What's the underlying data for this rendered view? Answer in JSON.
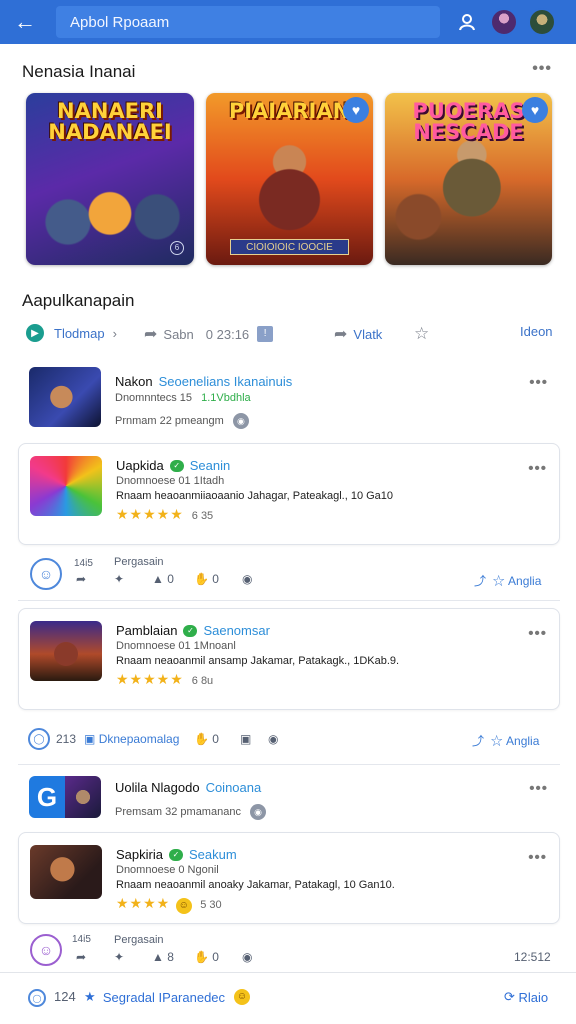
{
  "header": {
    "back_icon": "arrow-left-icon",
    "search_text": "Apbol Rpoaam",
    "user_icon": "user-outline-icon",
    "avatars": [
      "avatar-purple",
      "avatar-green"
    ],
    "accent": "#2f6fd6"
  },
  "featured": {
    "title": "Nenasia Inanai",
    "more": "•••",
    "cards": [
      {
        "title": "NANAERI NADANAEI",
        "badge": "6"
      },
      {
        "title": "PIAIARIAN",
        "banner": "CIOIOIOIC IOOCIE",
        "badge": "♥"
      },
      {
        "title": "PUOERAS NESCADE",
        "badge": "♥"
      }
    ]
  },
  "apps_section": {
    "title": "Aapulkanapain",
    "filters": {
      "trending": "Tlodmap",
      "trending_suffix": "›",
      "share": "Sabn",
      "count": "0 23:16",
      "count_badge": "!",
      "view": "Vlatk",
      "list": "Ideon"
    }
  },
  "apps": [
    {
      "name": "Nakon",
      "tag": "Seoenelians Ikanainuis",
      "line1": "Dnomnntecs 15",
      "line1_extra": "1.1Vbdhla",
      "line2": "Prnmam 22 pmeangm",
      "line2_icon": "eye-icon"
    },
    {
      "name": "Uapkida",
      "tag": "Seanin",
      "line1": "Dnomnoese 01 1Itadh",
      "line2": "Rnaam heaoanmiiaoaanio Jahagar, Pateakagl., 10 Ga10",
      "rating": "★★★★★",
      "score": "6 35"
    },
    {
      "name": "Pamblaian",
      "tag": "Saenomsar",
      "line1": "Dnomnoese 01 1Mnoanl",
      "line2": "Rnaam neaoanmil ansamp Jakamar, Patakagk., 1DKab.9.",
      "rating": "★★★★★",
      "score": "6 8u"
    },
    {
      "name": "Uolila Nlagodo",
      "tag": "Coinoana",
      "line1": "Premsam 32 pmamananc",
      "line1_icon": "eye-icon"
    },
    {
      "name": "Sapkiria",
      "tag": "Seakum",
      "line1": "Dnomnoese 0 Ngonil",
      "line2": "Rnaam neaoanmil anoaky Jakamar, Patakagl, 10 Gan10.",
      "rating": "★★★★",
      "score": "5 30"
    }
  ],
  "actions1": {
    "count": "14i5",
    "label": "Pergasain",
    "like": "0",
    "thumbs": "0",
    "share_label": "Anglia"
  },
  "actions2": {
    "count": "213",
    "label": "Dknepaomalag",
    "thumbs": "0",
    "share_label": "Anglia"
  },
  "actions3": {
    "count": "14i5",
    "label": "Pergasain",
    "like": "8",
    "thumbs": "0",
    "right": "12:512"
  },
  "bottom": {
    "count": "124",
    "label": "Segradal IParanedec",
    "right": "Rlaio"
  }
}
